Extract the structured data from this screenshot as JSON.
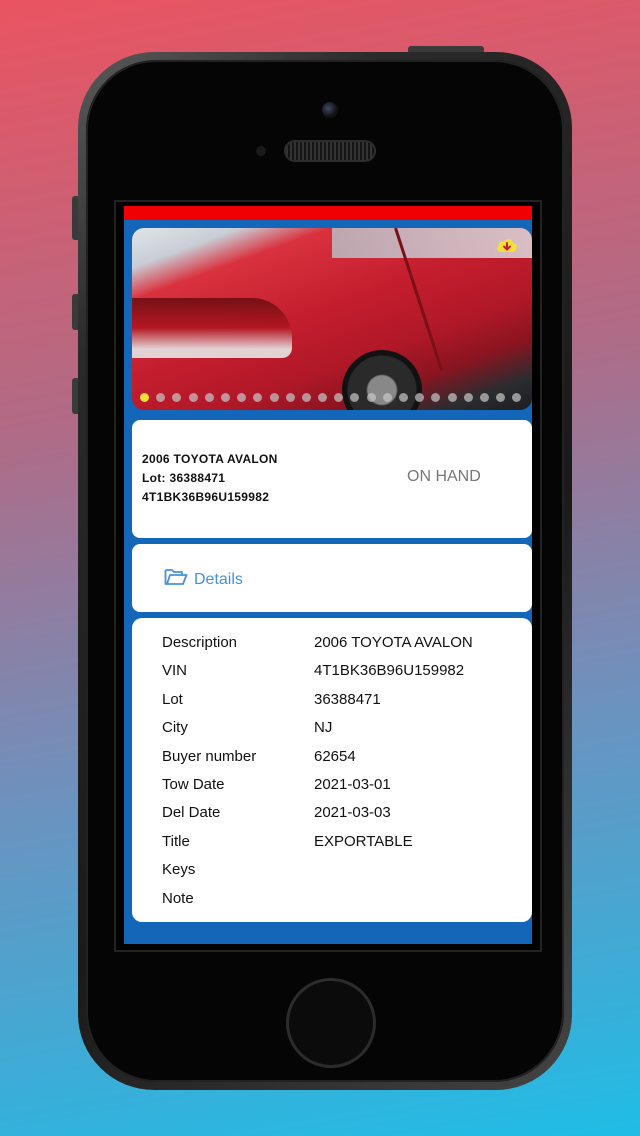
{
  "vehicle_summary": {
    "title": "2006 TOYOTA AVALON",
    "lot_line": "Lot: 36388471",
    "vin_line": "4T1BK36B96U159982",
    "status": "ON HAND"
  },
  "gallery": {
    "download_icon": "cloud-download-icon",
    "download_icon_color": "#f3e03a",
    "dot_count": 24,
    "active_dot": 0
  },
  "details_tab": {
    "icon": "folder-open-icon",
    "label": "Details",
    "color": "#4a90d9"
  },
  "details": [
    {
      "label": "Description",
      "value": "2006 TOYOTA AVALON"
    },
    {
      "label": "VIN",
      "value": "4T1BK36B96U159982"
    },
    {
      "label": "Lot",
      "value": "36388471"
    },
    {
      "label": "City",
      "value": "NJ"
    },
    {
      "label": "Buyer number",
      "value": "62654"
    },
    {
      "label": "Tow Date",
      "value": "2021-03-01"
    },
    {
      "label": "Del Date",
      "value": "2021-03-03"
    },
    {
      "label": "Title",
      "value": "EXPORTABLE"
    },
    {
      "label": "Keys",
      "value": ""
    },
    {
      "label": "Note",
      "value": ""
    }
  ],
  "colors": {
    "header_bar": "#f00000",
    "app_background": "#1467b8"
  }
}
